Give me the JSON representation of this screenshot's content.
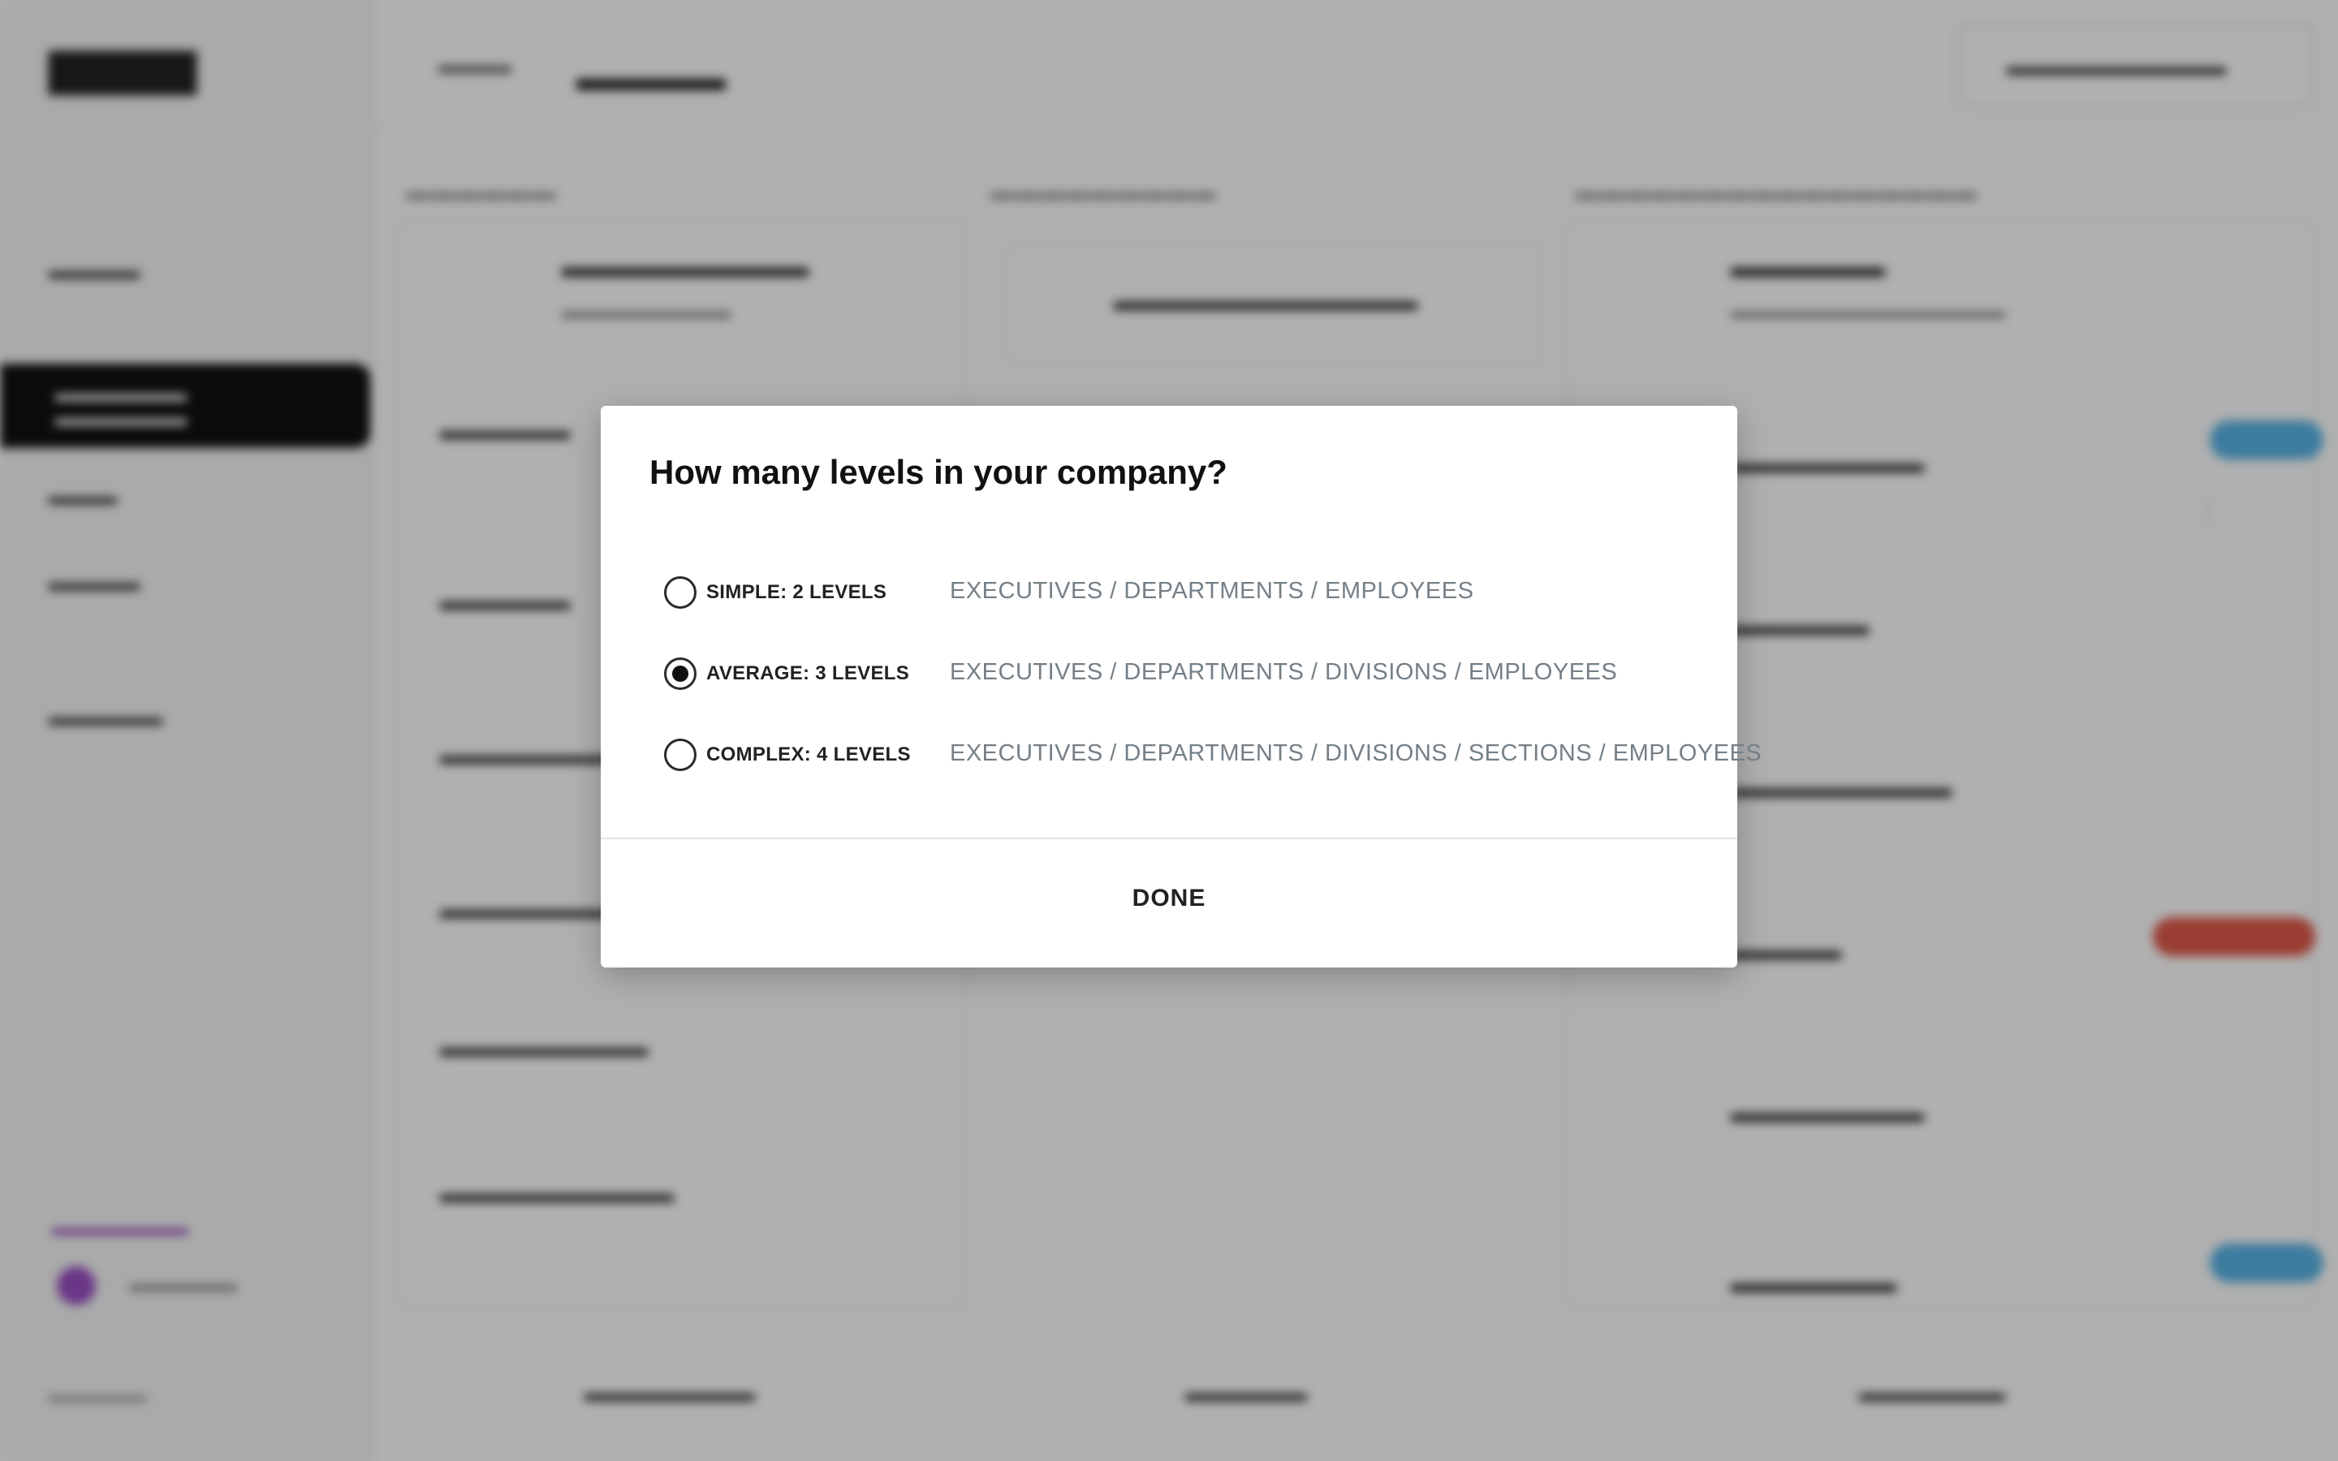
{
  "modal": {
    "title": "How many levels in your company?",
    "options": [
      {
        "label": "SIMPLE: 2 LEVELS",
        "description": "EXECUTIVES / DEPARTMENTS / EMPLOYEES",
        "checked": false
      },
      {
        "label": "AVERAGE: 3 LEVELS",
        "description": "EXECUTIVES / DEPARTMENTS / DIVISIONS / EMPLOYEES",
        "checked": true
      },
      {
        "label": "COMPLEX: 4 LEVELS",
        "description": "EXECUTIVES / DEPARTMENTS / DIVISIONS / SECTIONS / EMPLOYEES",
        "checked": false
      }
    ],
    "done_label": "DONE"
  },
  "colors": {
    "overlay": "#000000",
    "description_text": "#757f86",
    "background_accent_blue": "#5ab4e6",
    "background_accent_red": "#e05a4a",
    "background_accent_purple": "#9a4fc4"
  }
}
